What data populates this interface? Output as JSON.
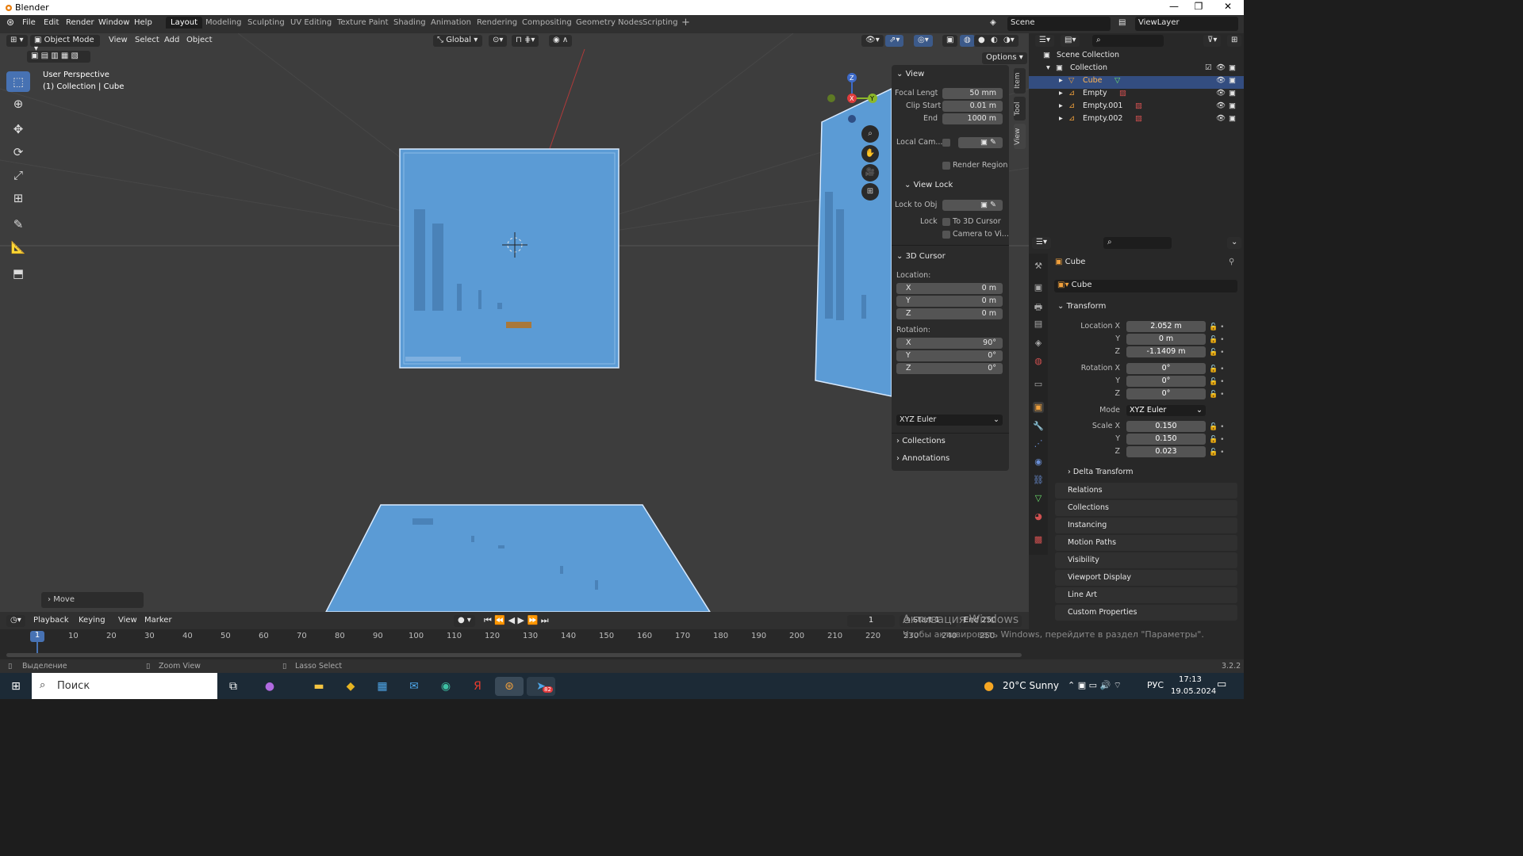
{
  "window": {
    "title": "Blender"
  },
  "menu": [
    "File",
    "Edit",
    "Render",
    "Window",
    "Help"
  ],
  "workspaces": [
    "Layout",
    "Modeling",
    "Sculpting",
    "UV Editing",
    "Texture Paint",
    "Shading",
    "Animation",
    "Rendering",
    "Compositing",
    "Geometry Nodes",
    "Scripting"
  ],
  "active_workspace": "Layout",
  "scene": "Scene",
  "view_layer": "ViewLayer",
  "viewport": {
    "mode": "Object Mode",
    "menus": [
      "View",
      "Select",
      "Add",
      "Object"
    ],
    "orientation": "Global",
    "options": "Options",
    "info_line1": "User Perspective",
    "info_line2": "(1) Collection | Cube",
    "last_op": "Move"
  },
  "gizmo": {
    "x": "X",
    "y": "Y",
    "z": "Z"
  },
  "npanel": {
    "tabs": [
      "Item",
      "Tool",
      "View"
    ],
    "view_header": "View",
    "focal_label": "Focal Lengt",
    "focal": "50 mm",
    "clip_start_label": "Clip Start",
    "clip_start": "0.01 m",
    "end_label": "End",
    "clip_end": "1000 m",
    "local_cam": "Local Cam...",
    "render_region": "Render Region",
    "view_lock": "View Lock",
    "lock_obj": "Lock to Obj",
    "lock": "Lock",
    "to_cursor": "To 3D Cursor",
    "cam_to_view": "Camera to Vi...",
    "cursor_header": "3D Cursor",
    "location": "Location:",
    "loc_x": "0 m",
    "loc_y": "0 m",
    "loc_z": "0 m",
    "rotation": "Rotation:",
    "rot_x": "90°",
    "rot_y": "0°",
    "rot_z": "0°",
    "rot_mode": "XYZ Euler",
    "collections": "Collections",
    "annotations": "Annotations",
    "axis_x": "X",
    "axis_y": "Y",
    "axis_z": "Z"
  },
  "outliner": {
    "root": "Scene Collection",
    "items": [
      "Collection",
      "Cube",
      "Empty",
      "Empty.001",
      "Empty.002"
    ]
  },
  "properties": {
    "object": "Cube",
    "data_name": "Cube",
    "transform": "Transform",
    "loc_x_label": "Location X",
    "loc_x": "2.052 m",
    "loc_y": "0 m",
    "loc_z": "-1.1409 m",
    "rot_x_label": "Rotation X",
    "rot_x": "0°",
    "rot_y": "0°",
    "rot_z": "0°",
    "mode_label": "Mode",
    "mode": "XYZ Euler",
    "scale_x_label": "Scale X",
    "scale_x": "0.150",
    "scale_y": "0.150",
    "scale_z": "0.023",
    "y": "Y",
    "z": "Z",
    "delta": "Delta Transform",
    "sections": [
      "Relations",
      "Collections",
      "Instancing",
      "Motion Paths",
      "Visibility",
      "Viewport Display",
      "Line Art",
      "Custom Properties"
    ]
  },
  "timeline": {
    "menus": [
      "Playback",
      "Keying",
      "View",
      "Marker"
    ],
    "current": "1",
    "start_label": "Start",
    "start": "1",
    "end_label": "End",
    "end": "250",
    "frame_marker": "1",
    "ticks": [
      "10",
      "20",
      "30",
      "40",
      "50",
      "60",
      "70",
      "80",
      "90",
      "100",
      "110",
      "120",
      "130",
      "140",
      "150",
      "160",
      "170",
      "180",
      "190",
      "200",
      "210",
      "220",
      "230",
      "240",
      "250"
    ]
  },
  "status": {
    "select": "Выделение",
    "zoom": "Zoom View",
    "lasso": "Lasso Select",
    "version": "3.2.2"
  },
  "watermark": {
    "line1": "Активация Windows",
    "line2": "Чтобы активировать Windows, перейдите в раздел \"Параметры\"."
  },
  "taskbar": {
    "search": "Поиск",
    "weather": "20°C Sunny",
    "lang": "РУС",
    "time": "17:13",
    "date": "19.05.2024",
    "badge": "82"
  }
}
